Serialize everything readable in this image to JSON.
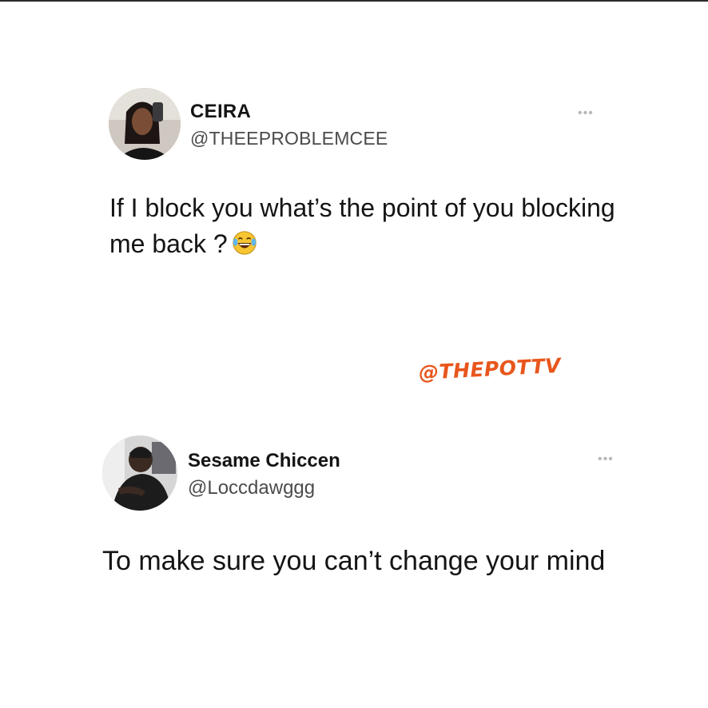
{
  "watermark": "@THEPOTTV",
  "tweets": [
    {
      "name": "CEIRA",
      "handle": "@THEEPROBLEMCEE",
      "more_icon": "more-dots-icon",
      "text": "If I block you what’s the point of you blocking me back ?",
      "emoji": "tears-of-joy-emoji"
    },
    {
      "name": "Sesame Chiccen",
      "handle": "@Loccdawggg",
      "more_icon": "more-dots-icon",
      "text": "To make sure you can’t change your mind"
    }
  ],
  "colors": {
    "watermark": "#e8561c",
    "name": "#141414",
    "handle": "#4b4b4b",
    "more": "#b8b8b8"
  }
}
